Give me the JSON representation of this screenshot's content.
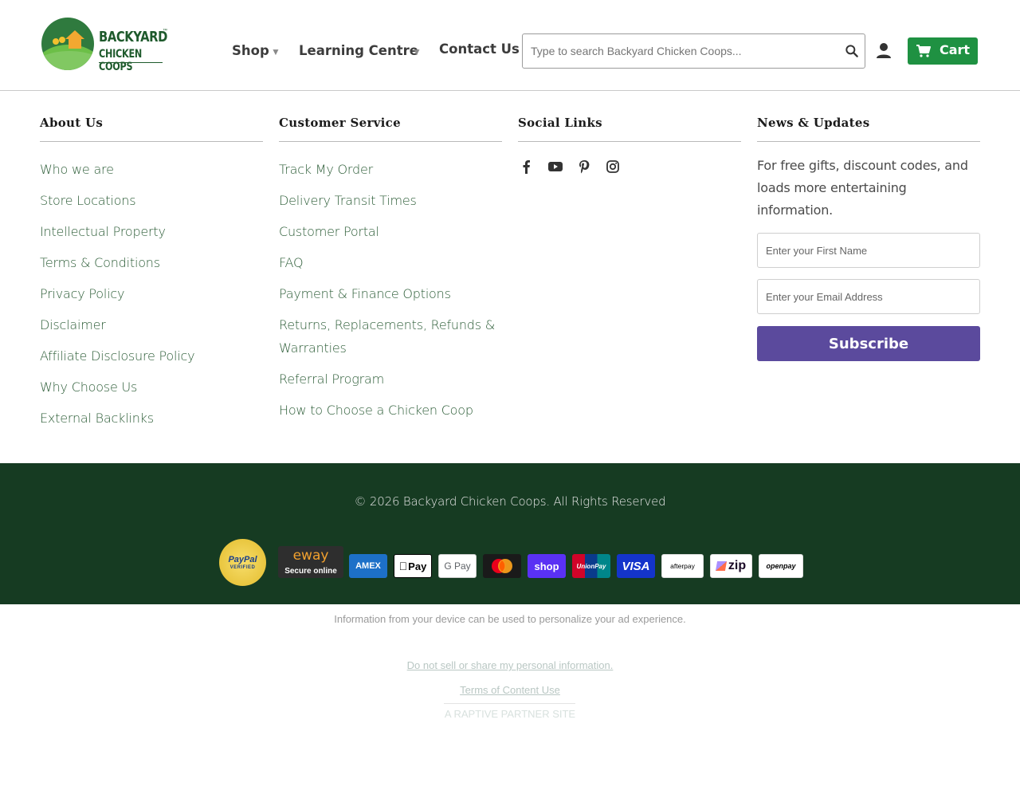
{
  "brand": {
    "logo_line1": "BACKYARD",
    "logo_tm": "™",
    "logo_line2": "CHICKEN COOPS",
    "logo_colors": {
      "dark_green": "#1e5a2c",
      "light_green": "#6cbf47",
      "orange": "#f2a831"
    }
  },
  "nav": {
    "items": [
      {
        "label": "Shop",
        "has_dropdown": true
      },
      {
        "label": "Learning Centre",
        "has_dropdown": true
      },
      {
        "label": "Contact Us",
        "has_dropdown": false
      }
    ],
    "caret": "▼"
  },
  "search": {
    "placeholder": "Type to search Backyard Chicken Coops...",
    "value": "",
    "icon": "search-icon"
  },
  "account": {
    "icon": "user-icon"
  },
  "cart": {
    "label": "Cart",
    "icon": "cart-icon",
    "color": "#1f9142"
  },
  "footer": {
    "about": {
      "title": "About Us",
      "links": [
        "Who we are",
        "Store Locations",
        "Intellectual Property",
        "Terms & Conditions",
        "Privacy Policy",
        "Disclaimer",
        "Affiliate Disclosure Policy",
        "Why Choose Us",
        "External Backlinks"
      ]
    },
    "service": {
      "title": "Customer Service",
      "links": [
        "Track My Order",
        "Delivery Transit Times",
        "Customer Portal",
        "FAQ",
        "Payment & Finance Options",
        "Returns, Replacements, Refunds & Warranties",
        "Referral Program",
        "How to Choose a Chicken Coop"
      ]
    },
    "social": {
      "title": "Social Links",
      "icons": [
        "facebook-icon",
        "youtube-icon",
        "pinterest-icon",
        "instagram-icon"
      ]
    },
    "news": {
      "title": "News & Updates",
      "text": "For free gifts, discount codes, and loads more entertaining information.",
      "first_name_placeholder": "Enter your First Name",
      "email_placeholder": "Enter your Email Address",
      "subscribe_label": "Subscribe",
      "subscribe_color": "#5b4a9d"
    }
  },
  "band": {
    "copyright": "© 2026 Backyard Chicken Coops. All Rights Reserved",
    "background": "#163b22",
    "paypal_seal": {
      "line1": "PayPal",
      "line2": "VERIFIED"
    },
    "eway": {
      "line1": "eway",
      "line2": "Secure online"
    },
    "payments": [
      {
        "name": "amex",
        "label": "AMEX"
      },
      {
        "name": "apple-pay",
        "label": "Pay"
      },
      {
        "name": "google-pay",
        "label": "G Pay"
      },
      {
        "name": "mastercard",
        "label": ""
      },
      {
        "name": "shop-pay",
        "label": "shop"
      },
      {
        "name": "unionpay",
        "label": "UnionPay"
      },
      {
        "name": "visa",
        "label": "VISA"
      },
      {
        "name": "afterpay",
        "label": "afterpay"
      },
      {
        "name": "zip",
        "label": "zip"
      },
      {
        "name": "openpay",
        "label": "openpay"
      }
    ]
  },
  "ads": {
    "info": "Information from your device can be used to personalize your ad experience.",
    "do_not_sell": "Do not sell or share my personal information.",
    "terms": "Terms of Content Use",
    "partner": "A RAPTIVE PARTNER SITE"
  }
}
